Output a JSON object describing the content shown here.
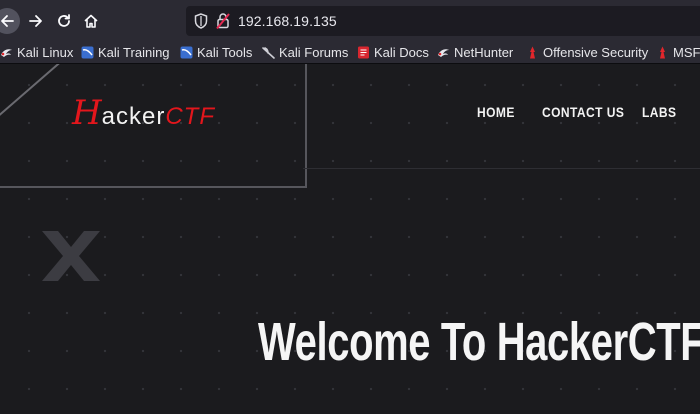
{
  "browser": {
    "url": "192.168.19.135",
    "bookmarks": [
      {
        "label": "Kali Linux",
        "icon": "kali-dragon-icon"
      },
      {
        "label": "Kali Training",
        "icon": "kali-training-icon"
      },
      {
        "label": "Kali Tools",
        "icon": "kali-tools-icon"
      },
      {
        "label": "Kali Forums",
        "icon": "kali-forums-icon"
      },
      {
        "label": "Kali Docs",
        "icon": "kali-docs-icon"
      },
      {
        "label": "NetHunter",
        "icon": "nethunter-icon"
      },
      {
        "label": "Offensive Security",
        "icon": "offsec-icon"
      },
      {
        "label": "MSFU",
        "icon": "msfu-icon"
      }
    ]
  },
  "site": {
    "logo": {
      "first": "H",
      "middle": "acker",
      "last": "CTF"
    },
    "nav": [
      "HOME",
      "CONTACT US",
      "LABS"
    ],
    "hero_title": "Welcome To HackerCTF C"
  },
  "colors": {
    "brand_red": "#e3161c",
    "page_bg": "#1b1b1e",
    "chrome_bg": "#2b2a33"
  }
}
